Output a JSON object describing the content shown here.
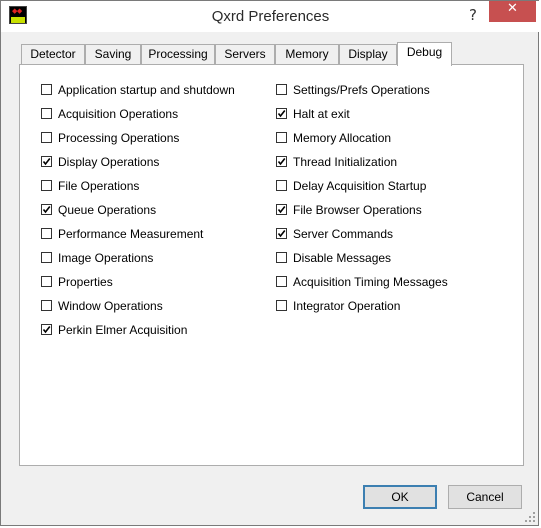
{
  "window": {
    "title": "Qxrd Preferences",
    "help_label": "?",
    "close_label": "✕"
  },
  "tabs": [
    {
      "label": "Detector",
      "active": false
    },
    {
      "label": "Saving",
      "active": false
    },
    {
      "label": "Processing",
      "active": false
    },
    {
      "label": "Servers",
      "active": false
    },
    {
      "label": "Memory",
      "active": false
    },
    {
      "label": "Display",
      "active": false
    },
    {
      "label": "Debug",
      "active": true
    }
  ],
  "left_options": [
    {
      "label": "Application startup and shutdown",
      "checked": false
    },
    {
      "label": "Acquisition Operations",
      "checked": false
    },
    {
      "label": "Processing Operations",
      "checked": false
    },
    {
      "label": "Display Operations",
      "checked": true
    },
    {
      "label": "File Operations",
      "checked": false
    },
    {
      "label": "Queue Operations",
      "checked": true
    },
    {
      "label": "Performance Measurement",
      "checked": false
    },
    {
      "label": "Image Operations",
      "checked": false
    },
    {
      "label": "Properties",
      "checked": false
    },
    {
      "label": "Window Operations",
      "checked": false
    },
    {
      "label": "Perkin Elmer Acquisition",
      "checked": true
    }
  ],
  "right_options": [
    {
      "label": "Settings/Prefs Operations",
      "checked": false
    },
    {
      "label": "Halt at exit",
      "checked": true
    },
    {
      "label": "Memory Allocation",
      "checked": false
    },
    {
      "label": "Thread Initialization",
      "checked": true
    },
    {
      "label": "Delay Acquisition Startup",
      "checked": false
    },
    {
      "label": "File Browser Operations",
      "checked": true
    },
    {
      "label": "Server Commands",
      "checked": true
    },
    {
      "label": "Disable Messages",
      "checked": false
    },
    {
      "label": "Acquisition Timing Messages",
      "checked": false
    },
    {
      "label": "Integrator Operation",
      "checked": false
    }
  ],
  "buttons": {
    "ok_label": "OK",
    "cancel_label": "Cancel"
  },
  "colors": {
    "accent": "#3c7fb1",
    "close": "#c75050"
  }
}
